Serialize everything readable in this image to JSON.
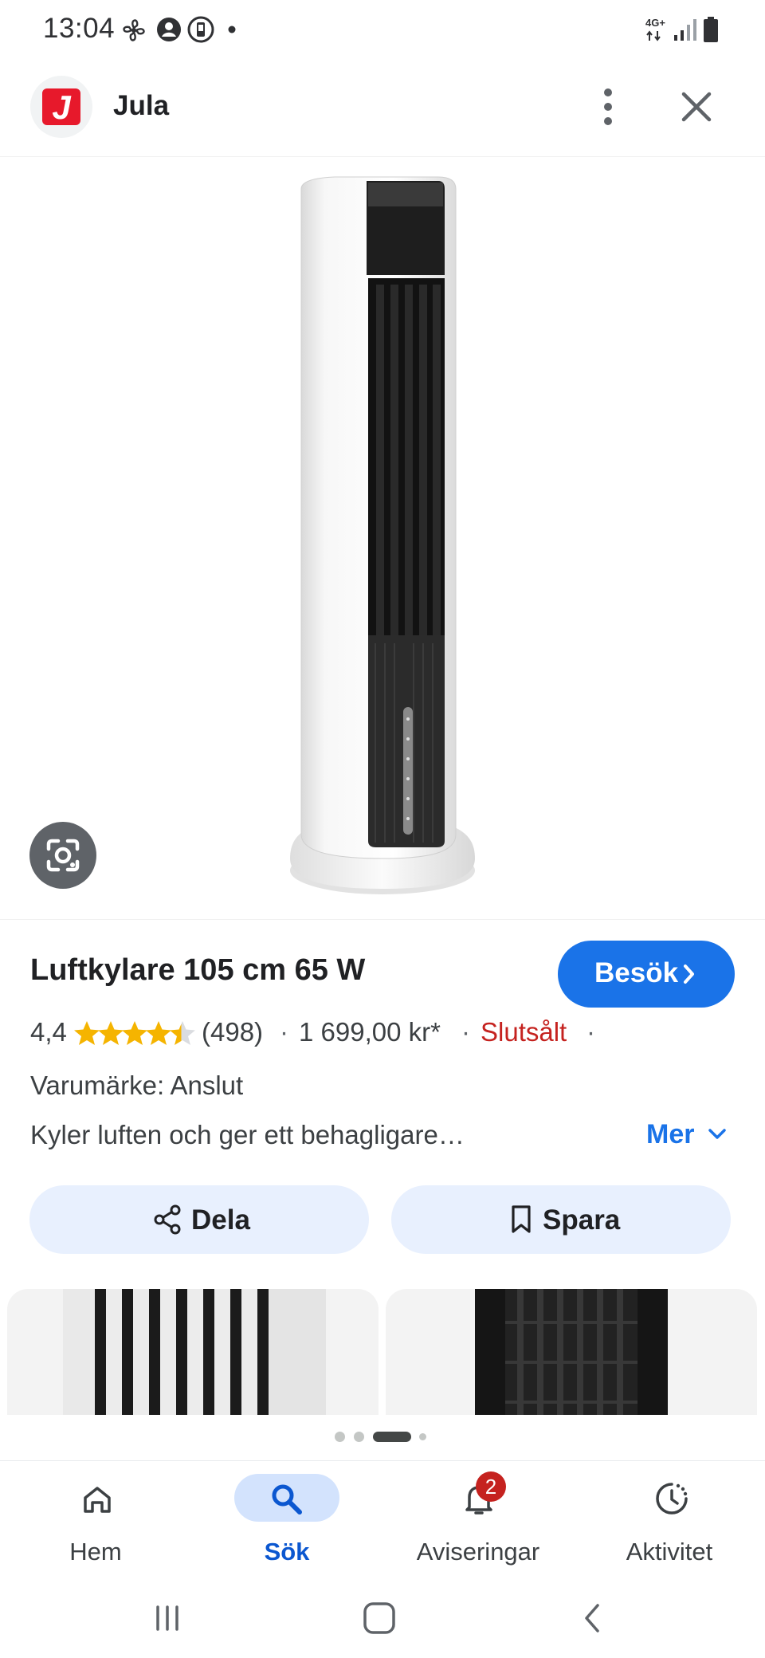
{
  "status_bar": {
    "time": "13:04",
    "network": "4G+"
  },
  "header": {
    "site_name": "Jula",
    "logo_letter": "J"
  },
  "product": {
    "title": "Luftkylare 105 cm 65 W",
    "visit_label": "Besök",
    "rating": "4,4",
    "stars": 4.4,
    "review_count": "(498)",
    "price": "1 699,00 kr*",
    "availability": "Slutsålt",
    "brand": "Varumärke: Anslut",
    "description": "Kyler luften och ger ett behagligare…",
    "more_label": "Mer"
  },
  "actions": {
    "share_label": "Dela",
    "save_label": "Spara"
  },
  "bottom_nav": {
    "items": [
      {
        "label": "Hem",
        "icon": "home-icon"
      },
      {
        "label": "Sök",
        "icon": "search-icon"
      },
      {
        "label": "Aviseringar",
        "icon": "bell-icon",
        "badge": "2"
      },
      {
        "label": "Aktivitet",
        "icon": "activity-icon"
      }
    ]
  },
  "colors": {
    "accent": "#1a73e8",
    "sold_out": "#c5221f",
    "star": "#f5b400",
    "pill_bg": "#e8f0fe"
  }
}
